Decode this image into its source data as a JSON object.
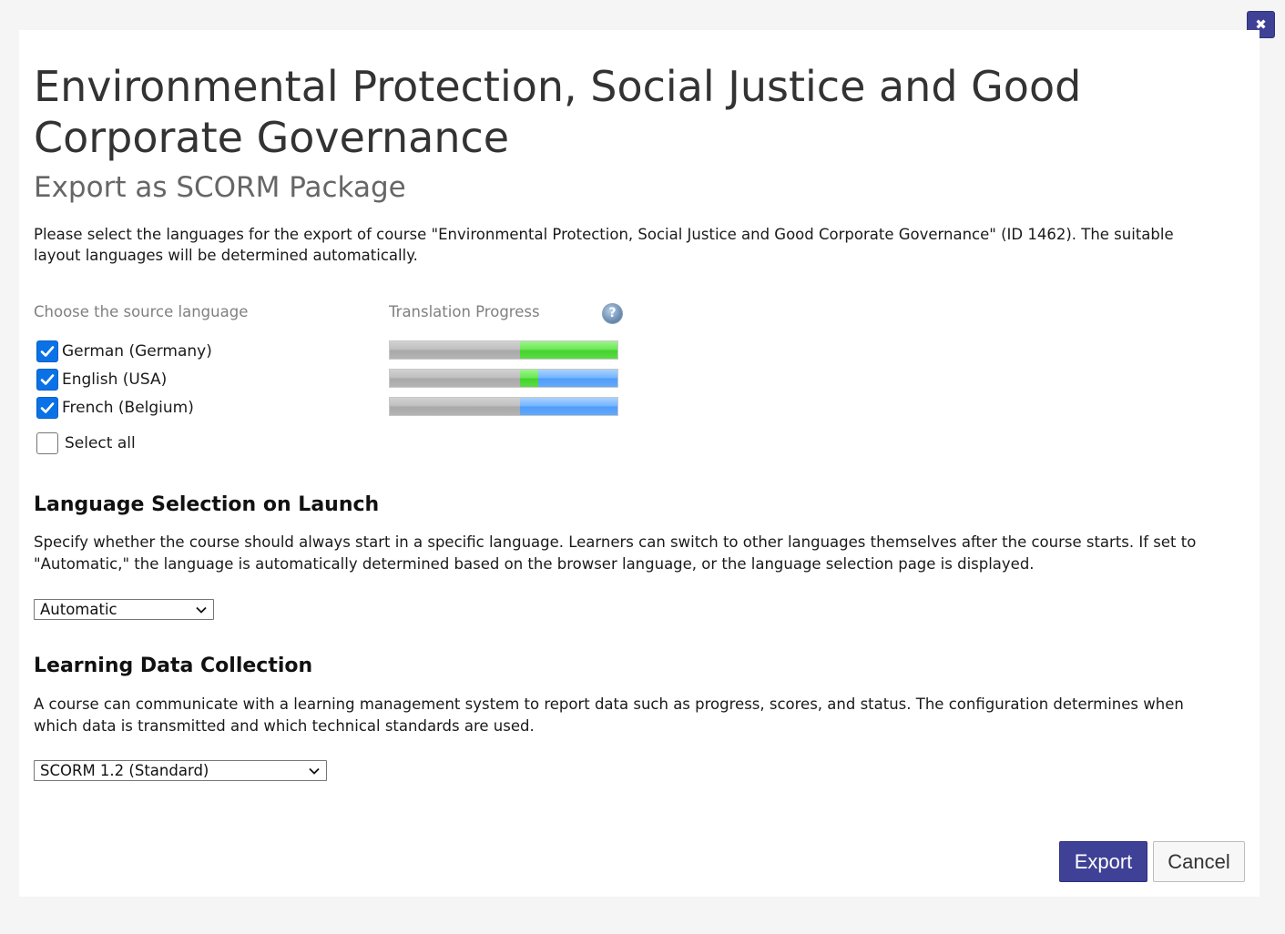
{
  "dialog": {
    "title": "Environmental Protection, Social Justice and Good Corporate Governance",
    "subtitle": "Export as SCORM Package",
    "intro": "Please select the languages for the export of course \"Environmental Protection, Social Justice and Good Corporate Governance\" (ID 1462). The suitable layout languages will be determined automatically.",
    "close_icon": "close-icon"
  },
  "languages": {
    "header_source": "Choose the source language",
    "header_progress": "Translation Progress",
    "help_icon": "help-icon",
    "items": [
      {
        "label": "German (Germany)",
        "checked": true,
        "progress": {
          "gray": 0.57,
          "green": 0.43,
          "blue": 0.0
        }
      },
      {
        "label": "English (USA)",
        "checked": true,
        "progress": {
          "gray": 0.57,
          "green": 0.08,
          "blue": 0.35
        }
      },
      {
        "label": "French (Belgium)",
        "checked": true,
        "progress": {
          "gray": 0.57,
          "green": 0.0,
          "blue": 0.43
        }
      }
    ],
    "select_all_label": "Select all",
    "select_all_checked": false
  },
  "launch": {
    "title": "Language Selection on Launch",
    "text": "Specify whether the course should always start in a specific language. Learners can switch to other languages themselves after the course starts. If set to \"Automatic,\" the language is automatically determined based on the browser language, or the language selection page is displayed.",
    "selected": "Automatic"
  },
  "collection": {
    "title": "Learning Data Collection",
    "text": "A course can communicate with a learning management system to report data such as progress, scores, and status. The configuration determines when which data is transmitted and which technical standards are used.",
    "selected": "SCORM 1.2 (Standard)"
  },
  "buttons": {
    "export": "Export",
    "cancel": "Cancel"
  },
  "colors": {
    "accent": "#3f4196",
    "checkbox": "#0a72e6",
    "progress_green": "#5bdc45",
    "progress_blue": "#63a9fb",
    "progress_gray": "#b4b4b4"
  }
}
